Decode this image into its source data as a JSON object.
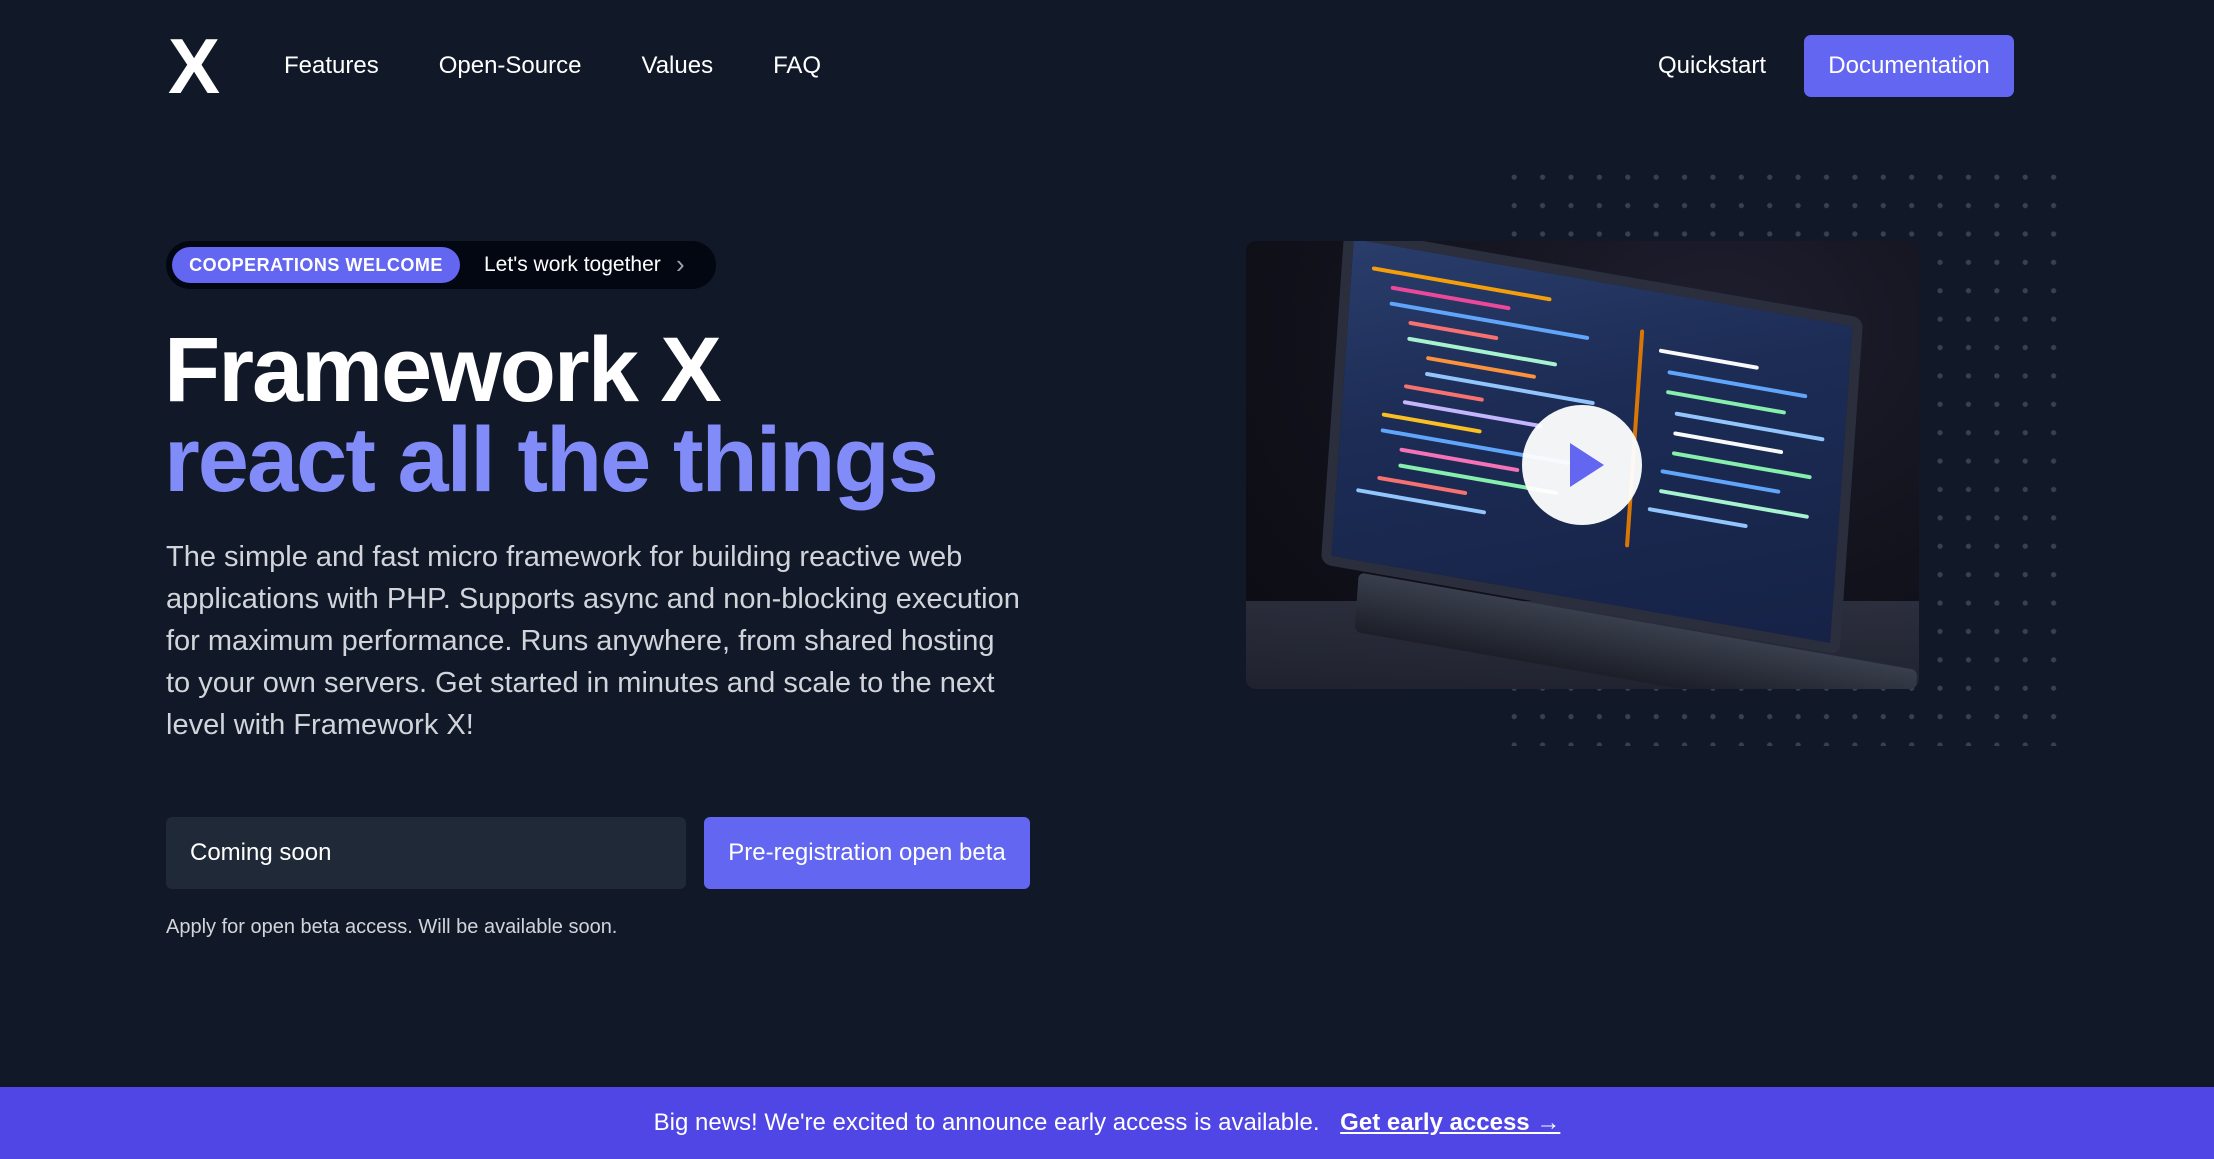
{
  "nav": {
    "logo": "X",
    "links": [
      {
        "label": "Features"
      },
      {
        "label": "Open-Source"
      },
      {
        "label": "Values"
      },
      {
        "label": "FAQ"
      }
    ],
    "quickstart_label": "Quickstart",
    "documentation_label": "Documentation"
  },
  "badge": {
    "pill_label": "COOPERATIONS WELCOME",
    "text": "Let's work together",
    "chevron": "›"
  },
  "hero": {
    "title_line1": "Framework X",
    "title_line2": "react all the things",
    "description": "The simple and fast micro framework for building reactive web applications with PHP. Supports async and non-blocking execution for maximum performance. Runs anywhere, from shared hosting to your own servers. Get started in minutes and scale to the next level with Framework X!"
  },
  "form": {
    "input_placeholder": "Coming soon",
    "button_label": "Pre-registration open beta",
    "hint": "Apply for open beta access. Will be available soon."
  },
  "video": {
    "icon": "play-icon"
  },
  "banner": {
    "text": "Big news! We're excited to announce early access is available.",
    "link_label": "Get early access →"
  },
  "colors": {
    "background": "#111827",
    "accent": "#6366f1",
    "accent_light": "#818cf8",
    "banner": "#4f46e5"
  }
}
